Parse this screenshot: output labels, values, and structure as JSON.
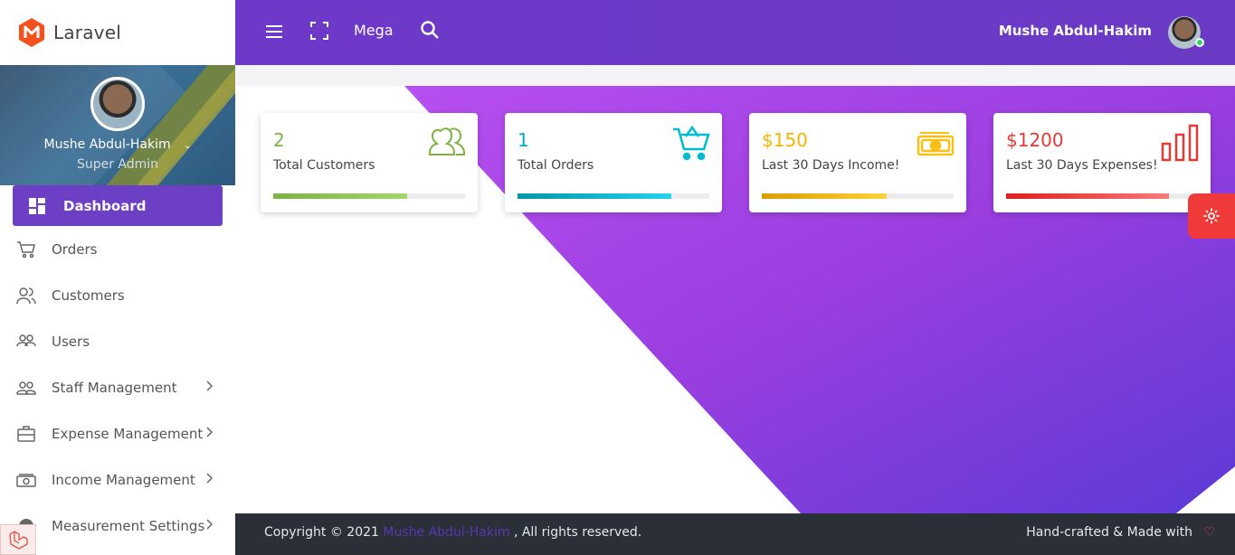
{
  "brand": {
    "name": "Laravel",
    "logo_letter": "M",
    "logo_color": "#f4511e"
  },
  "profile": {
    "name": "Mushe Abdul-Hakim",
    "role": "Super Admin"
  },
  "sidebar": {
    "active": {
      "label": "Dashboard",
      "icon": "dashboard-icon"
    },
    "items": [
      {
        "label": "Orders",
        "icon": "cart-icon",
        "has_submenu": false
      },
      {
        "label": "Customers",
        "icon": "user-group-icon",
        "has_submenu": false
      },
      {
        "label": "Users",
        "icon": "users-icon",
        "has_submenu": false
      },
      {
        "label": "Staff Management",
        "icon": "staff-icon",
        "has_submenu": true
      },
      {
        "label": "Expense Management",
        "icon": "briefcase-icon",
        "has_submenu": true
      },
      {
        "label": "Income Management",
        "icon": "money-icon",
        "has_submenu": true
      },
      {
        "label": "Measurement Settings",
        "icon": "settings-icon",
        "has_submenu": true
      }
    ]
  },
  "topbar": {
    "mega_label": "Mega",
    "user_name": "Mushe Abdul-Hakim"
  },
  "cards": [
    {
      "value": "2",
      "label": "Total Customers",
      "color": "#7cb342",
      "progress": 0.75,
      "icon": "customers-icon"
    },
    {
      "value": "1",
      "label": "Total Orders",
      "color": "#00bcd4",
      "progress": 0.8,
      "icon": "shopping-cart-icon"
    },
    {
      "value": "$150",
      "label": "Last 30 Days Income!",
      "color": "#f9bf17",
      "progress": 0.65,
      "icon": "cash-icon"
    },
    {
      "value": "$1200",
      "label": "Last 30 Days Expenses!",
      "color": "#e53935",
      "progress": 0.85,
      "icon": "bar-chart-icon"
    }
  ],
  "footer": {
    "copyright_prefix": "Copyright © 2021",
    "author_link": "Mushe Abdul-Hakim",
    "copyright_suffix": ", All rights reserved.",
    "made_with": "Hand-crafted & Made with"
  },
  "colors": {
    "primary": "#6c3fc4",
    "footer_bg": "#2a2f38",
    "accent_red": "#f03a3a"
  }
}
